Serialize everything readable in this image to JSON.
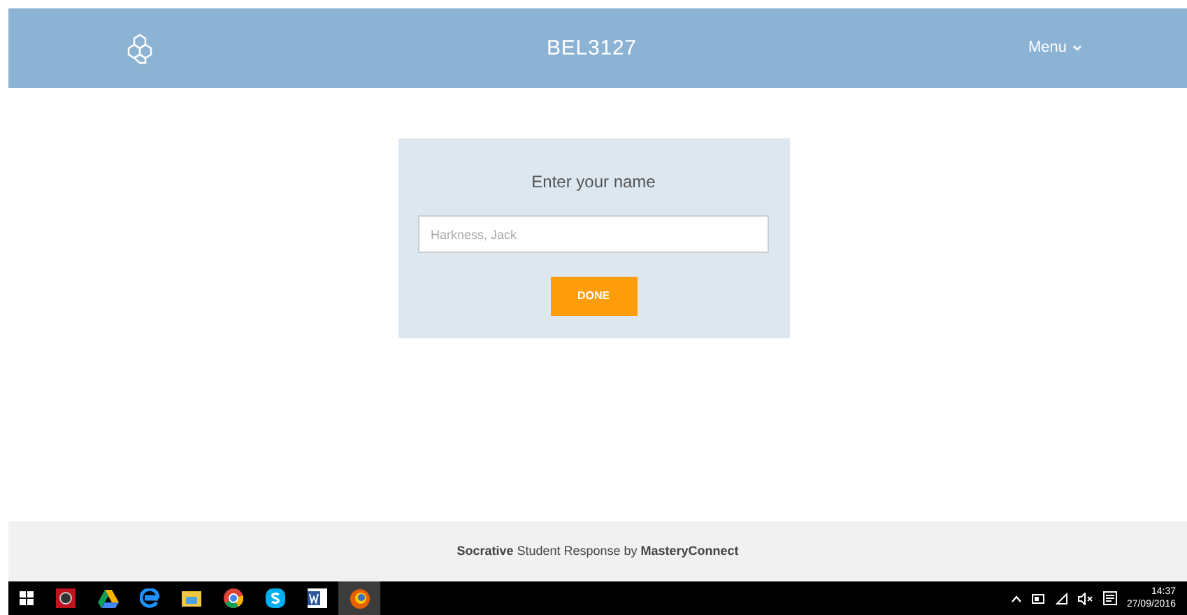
{
  "header": {
    "title": "BEL3127",
    "menu": "Menu"
  },
  "form": {
    "heading": "Enter your name",
    "name_field": {
      "placeholder": "Harkness, Jack"
    },
    "done_button": "DONE"
  },
  "footer": {
    "text": "**Socrative** Student Response by **MasteryConnect**"
  },
  "taskbar": {
    "apps": [
      {
        "kind": "recorder",
        "selected": false
      },
      {
        "kind": "drive",
        "selected": false
      },
      {
        "kind": "edge",
        "selected": false
      },
      {
        "kind": "folder",
        "selected": false
      },
      {
        "kind": "chrome",
        "selected": false
      },
      {
        "kind": "skype",
        "selected": false
      },
      {
        "kind": "word",
        "selected": false
      },
      {
        "kind": "firefox",
        "selected": true
      }
    ],
    "clock": {
      "time": "14:37",
      "date": "27/09/2016"
    }
  }
}
